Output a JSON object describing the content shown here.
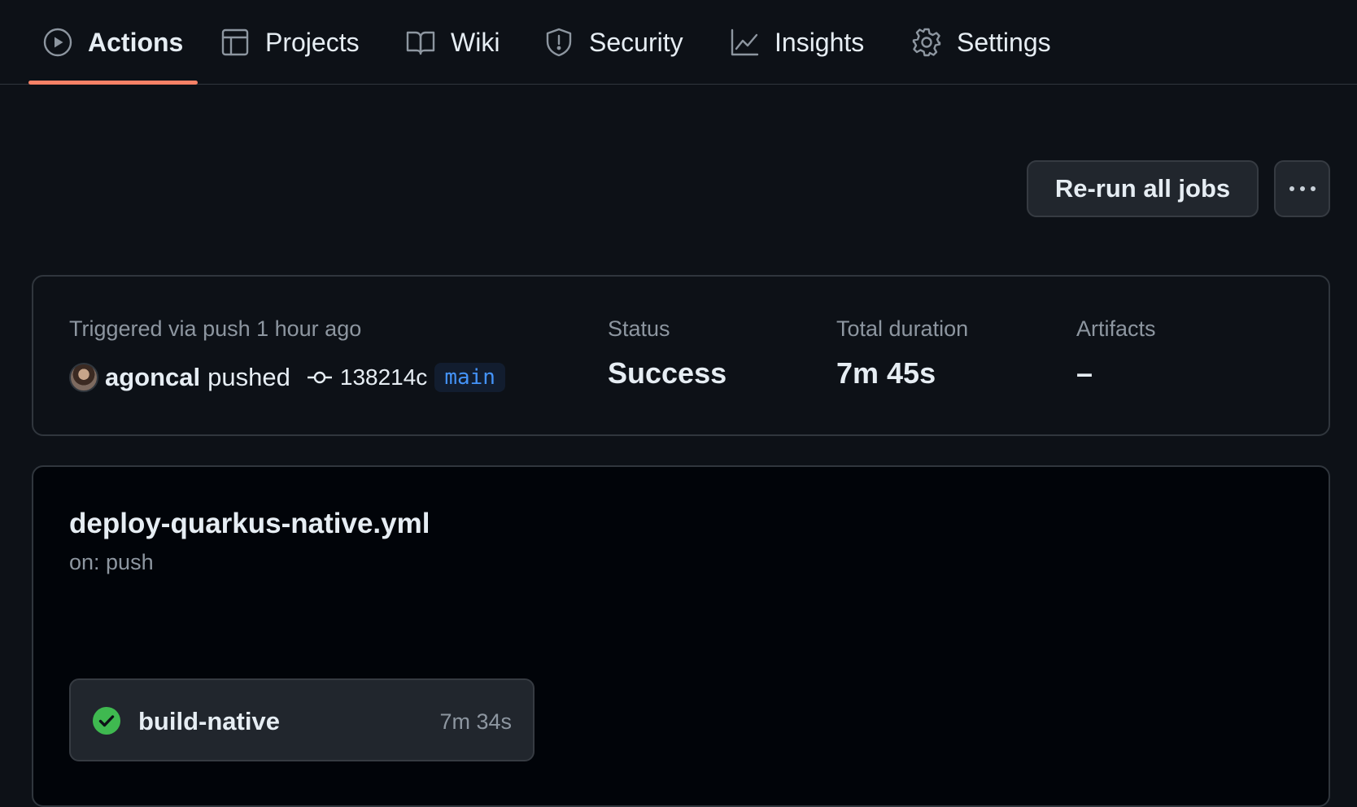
{
  "nav": {
    "tabs": [
      {
        "label": "Actions",
        "icon": "play-icon",
        "active": true
      },
      {
        "label": "Projects",
        "icon": "table-icon",
        "active": false
      },
      {
        "label": "Wiki",
        "icon": "book-icon",
        "active": false
      },
      {
        "label": "Security",
        "icon": "shield-icon",
        "active": false
      },
      {
        "label": "Insights",
        "icon": "graph-icon",
        "active": false
      },
      {
        "label": "Settings",
        "icon": "gear-icon",
        "active": false
      }
    ]
  },
  "header": {
    "rerun_label": "Re-run all jobs",
    "more_icon": "kebab-horizontal-icon"
  },
  "summary": {
    "trigger_label": "Triggered via push 1 hour ago",
    "actor": "agoncal",
    "action": "pushed",
    "commit_sha": "138214c",
    "branch": "main",
    "status_label": "Status",
    "status_value": "Success",
    "duration_label": "Total duration",
    "duration_value": "7m 45s",
    "artifacts_label": "Artifacts",
    "artifacts_value": "–"
  },
  "workflow": {
    "file": "deploy-quarkus-native.yml",
    "trigger": "on: push",
    "jobs": [
      {
        "name": "build-native",
        "duration": "7m 34s",
        "status": "success",
        "status_color": "#3fb950"
      }
    ]
  },
  "colors": {
    "background": "#0d1117",
    "tab_underline": "#f78166",
    "branch_text": "#4493f8",
    "success": "#3fb950"
  }
}
